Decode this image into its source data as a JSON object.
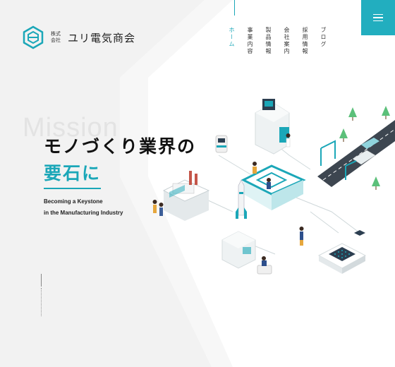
{
  "brand": {
    "small_label": "株式会社",
    "name": "ユリ電気商会",
    "accent_color": "#22aebf"
  },
  "nav": {
    "items": [
      {
        "label": "ホーム",
        "active": true
      },
      {
        "label": "事業内容",
        "active": false
      },
      {
        "label": "製品情報",
        "active": false
      },
      {
        "label": "会社案内",
        "active": false
      },
      {
        "label": "採用情報",
        "active": false
      },
      {
        "label": "ブログ",
        "active": false
      }
    ],
    "menu_icon": "hamburger-icon"
  },
  "hero": {
    "bg_word": "Mission",
    "headline_line1": "モノづくり業界の",
    "headline_line2": "要石に",
    "sub_line1": "Becoming a Keystone",
    "sub_line2": "in the Manufacturing Industry"
  }
}
